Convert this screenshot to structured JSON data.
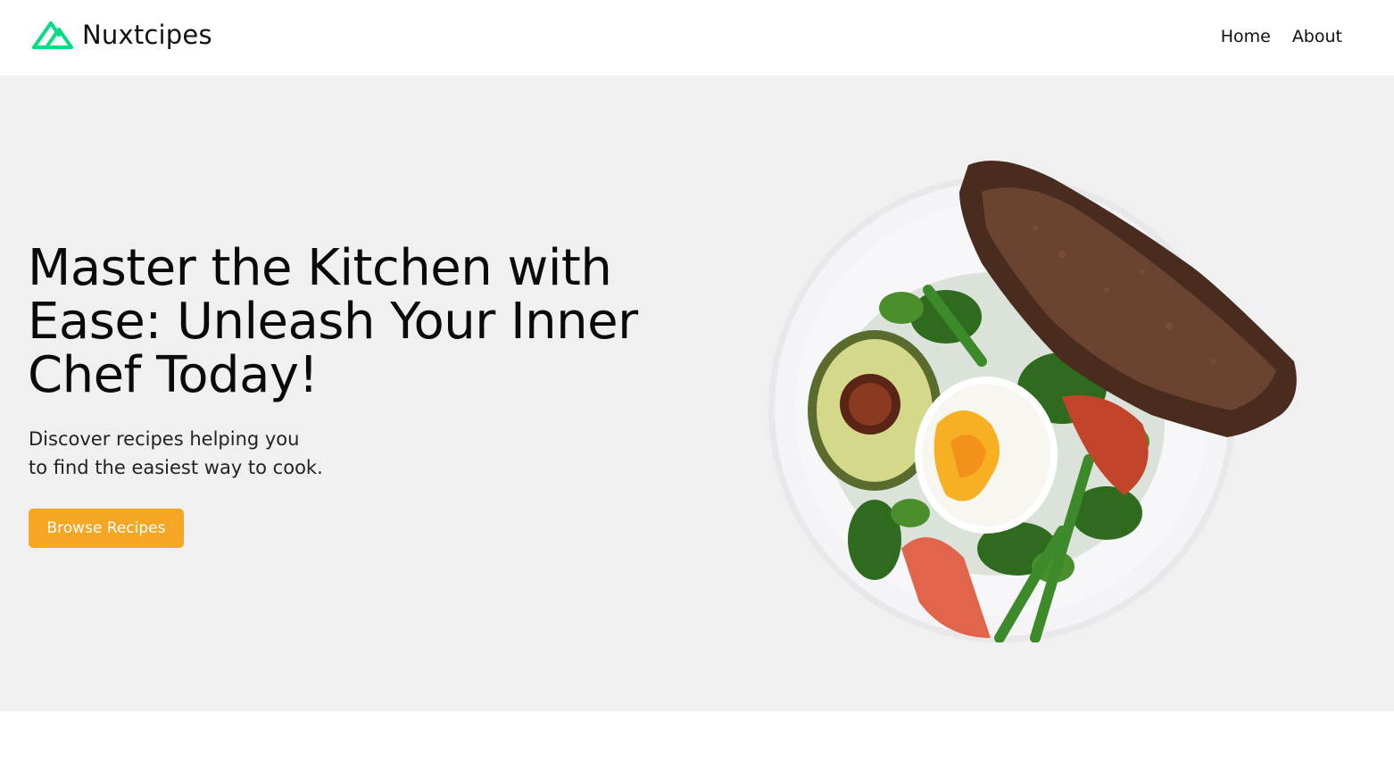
{
  "nav": {
    "brand": "Nuxtcipes",
    "links": [
      {
        "label": "Home"
      },
      {
        "label": "About"
      }
    ]
  },
  "hero": {
    "title": "Master the Kitchen with Ease: Unleash Your Inner Chef Today!",
    "subtitle_lines": [
      "Discover recipes helping you",
      "to find the easiest way to cook."
    ],
    "cta_label": "Browse Recipes"
  },
  "colors": {
    "brand_green": "#00dc82",
    "accent_orange": "#f5a623",
    "hero_background": "#f0f0f0"
  },
  "icons": {
    "brand_logo": "nuxt-logo-icon"
  }
}
